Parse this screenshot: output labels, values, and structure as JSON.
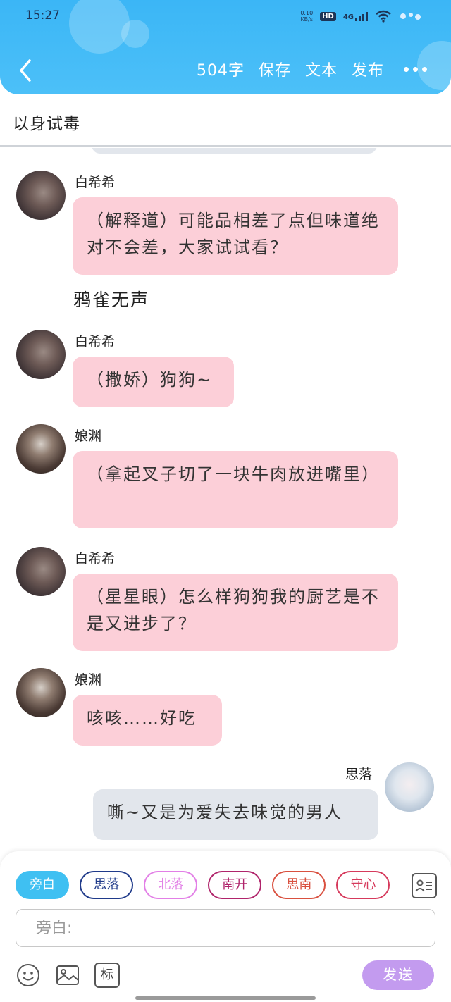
{
  "status": {
    "time": "15:27",
    "net_speed_top": "0.10",
    "net_speed_bottom": "KB/s",
    "hd": "HD",
    "signal": "4G"
  },
  "toolbar": {
    "word_count": "504字",
    "save": "保存",
    "text": "文本",
    "publish": "发布"
  },
  "title": "以身试毒",
  "messages": [
    {
      "name": "白希希",
      "text": "（解释道）可能品相差了点但味道绝对不会差，大家试试看？"
    },
    {
      "narration": "鸦雀无声"
    },
    {
      "name": "白希希",
      "text": "（撒娇）狗狗~"
    },
    {
      "name": "娘渊",
      "text": "（拿起叉子切了一块牛肉放进嘴里）"
    },
    {
      "name": "白希希",
      "text": "（星星眼）怎么样狗狗我的厨艺是不是又进步了？"
    },
    {
      "name": "娘渊",
      "text": "咳咳……好吃"
    },
    {
      "name": "思落",
      "text": "嘶~又是为爱失去味觉的男人"
    }
  ],
  "composer": {
    "chips": [
      {
        "label": "旁白",
        "color": "#3fc0f2"
      },
      {
        "label": "思落",
        "color": "#1f3a8a"
      },
      {
        "label": "北落",
        "color": "#e27fe6"
      },
      {
        "label": "南开",
        "color": "#b0246b"
      },
      {
        "label": "思南",
        "color": "#d9503f"
      },
      {
        "label": "守心",
        "color": "#d63a5c"
      }
    ],
    "input_placeholder": "旁白:",
    "tool_mark": "标",
    "send": "发送"
  }
}
